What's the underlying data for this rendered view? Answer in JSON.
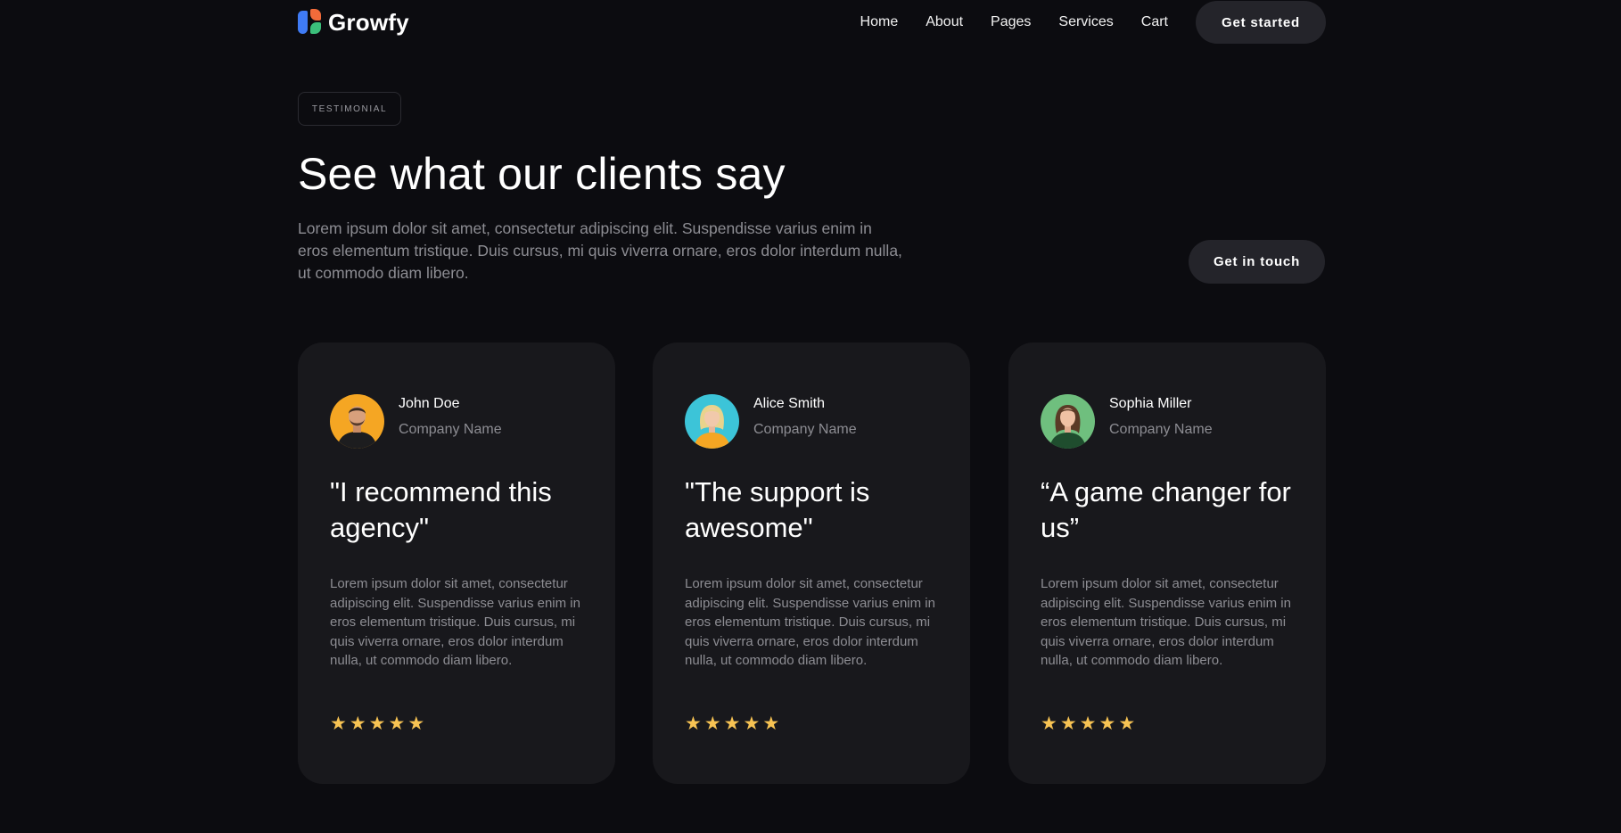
{
  "brand": {
    "name": "Growfy",
    "colors": {
      "blue": "#3f7bf5",
      "orange": "#f26b3a",
      "green": "#3bbf7a"
    }
  },
  "nav": {
    "links": [
      "Home",
      "About",
      "Pages",
      "Services",
      "Cart"
    ],
    "cta": "Get started"
  },
  "section": {
    "tag": "TESTIMONIAL",
    "title": "See what our clients say",
    "description": "Lorem ipsum dolor sit amet, consectetur adipiscing elit. Suspendisse varius enim in eros elementum tristique. Duis cursus, mi quis viverra ornare, eros dolor interdum nulla, ut commodo diam libero.",
    "cta": "Get in touch"
  },
  "testimonials": [
    {
      "name": "John Doe",
      "company": "Company Name",
      "quote": "\"I recommend this agency\"",
      "body": "Lorem ipsum dolor sit amet, consectetur adipiscing elit. Suspendisse varius enim in eros elementum tristique. Duis cursus, mi quis viverra ornare, eros dolor interdum nulla, ut commodo diam libero.",
      "rating": 5,
      "avatar_bg": "#f5a623"
    },
    {
      "name": "Alice Smith",
      "company": "Company Name",
      "quote": "\"The support is awesome\"",
      "body": "Lorem ipsum dolor sit amet, consectetur adipiscing elit. Suspendisse varius enim in eros elementum tristique. Duis cursus, mi quis viverra ornare, eros dolor interdum nulla, ut commodo diam libero.",
      "rating": 5,
      "avatar_bg": "#3cc4d8"
    },
    {
      "name": "Sophia Miller",
      "company": "Company Name",
      "quote": "“A game changer for us”",
      "body": "Lorem ipsum dolor sit amet, consectetur adipiscing elit. Suspendisse varius enim in eros elementum tristique. Duis cursus, mi quis viverra ornare, eros dolor interdum nulla, ut commodo diam libero.",
      "rating": 5,
      "avatar_bg": "#6fbf7e"
    }
  ],
  "colors": {
    "background": "#0c0c10",
    "card": "#18181c",
    "button": "#24242a",
    "muted_text": "#8d8d93",
    "star": "#f7c353"
  }
}
